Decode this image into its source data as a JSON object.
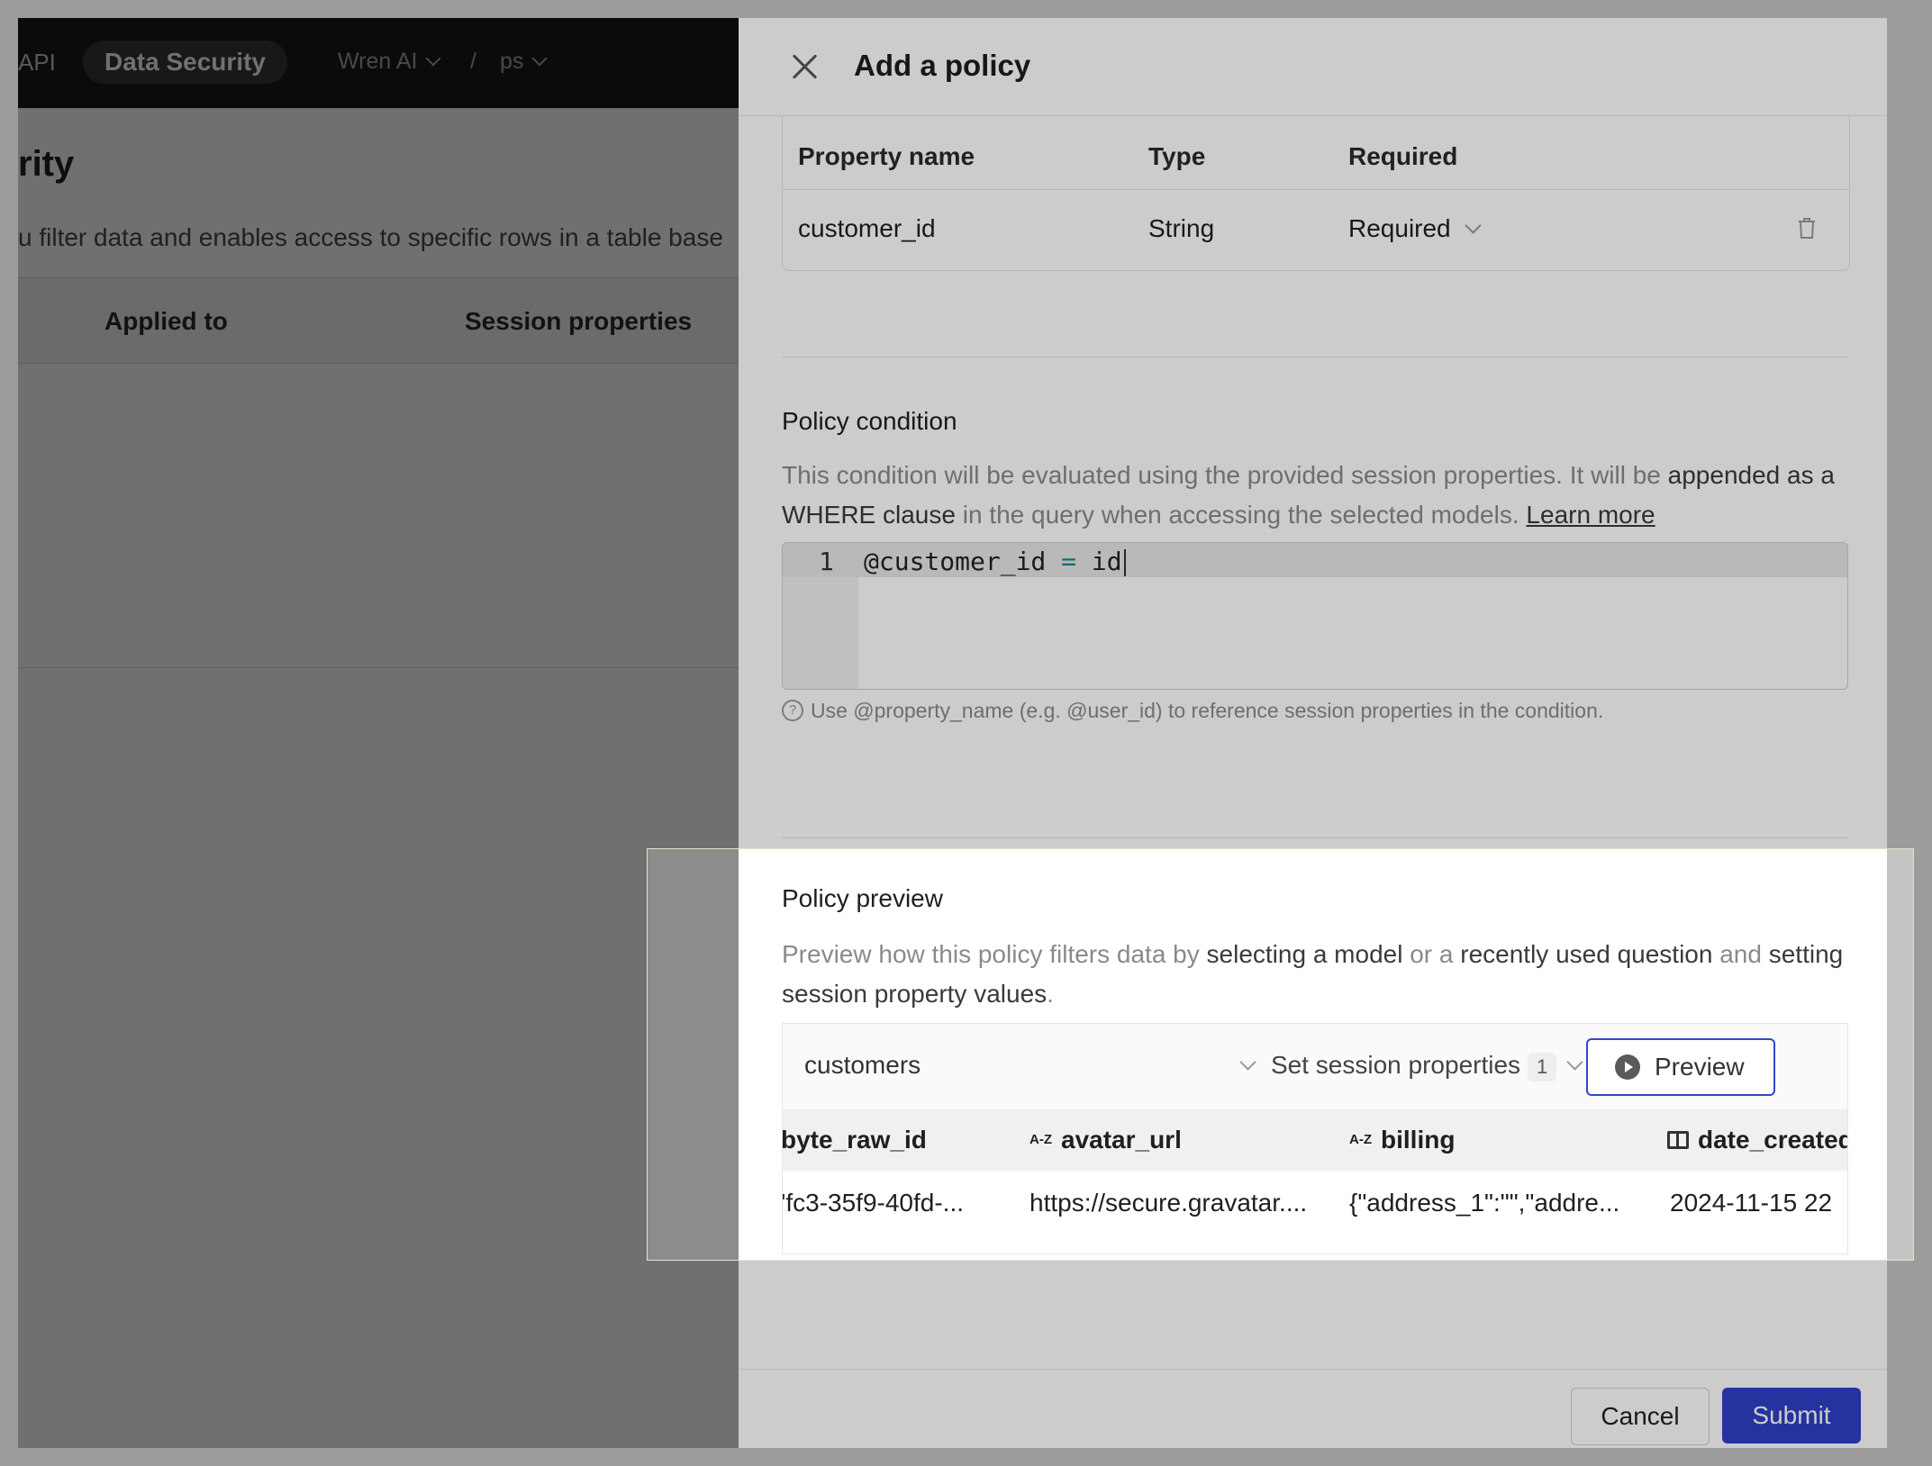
{
  "topbar": {
    "nav_api": "API",
    "nav_active": "Data Security",
    "project": "Wren AI",
    "separator": "/",
    "branch": "ps"
  },
  "page": {
    "title": "rity",
    "description": "u filter data and enables access to specific rows in a table base",
    "columns": [
      "Applied to",
      "Session properties"
    ]
  },
  "drawer": {
    "title": "Add a policy",
    "properties_table": {
      "headers": [
        "Property name",
        "Type",
        "Required"
      ],
      "rows": [
        {
          "name": "customer_id",
          "type": "String",
          "required": "Required"
        }
      ]
    },
    "condition": {
      "title": "Policy condition",
      "desc_1": "This condition will be evaluated using the provided session properties. It will be ",
      "desc_em": "appended as a WHERE clause",
      "desc_2": " in the query when accessing the selected models. ",
      "learn_more": "Learn more",
      "line_number": "1",
      "code_left": "@customer_id ",
      "code_op": "=",
      "code_right": " id",
      "hint": "Use @property_name (e.g. @user_id) to reference session properties in the condition."
    },
    "preview": {
      "title": "Policy preview",
      "desc_1": "Preview how this policy filters data by ",
      "desc_em1": "selecting a model",
      "desc_2": " or a ",
      "desc_em2": "recently used question",
      "desc_3": " and ",
      "desc_em3": "setting session property values",
      "desc_4": ".",
      "model": "customers",
      "session_label": "Set session properties",
      "session_count": "1",
      "preview_label": "Preview",
      "columns": [
        {
          "icon": "",
          "name": "byte_raw_id"
        },
        {
          "icon": "A-Z",
          "name": "avatar_url"
        },
        {
          "icon": "A-Z",
          "name": "billing"
        },
        {
          "icon": "table",
          "name": "date_created"
        }
      ],
      "row": [
        "'fc3-35f9-40fd-...",
        "https://secure.gravatar....",
        "{\"address_1\":\"\",\"addre...",
        "2024-11-15 22"
      ]
    },
    "footer": {
      "cancel": "Cancel",
      "submit": "Submit"
    }
  }
}
